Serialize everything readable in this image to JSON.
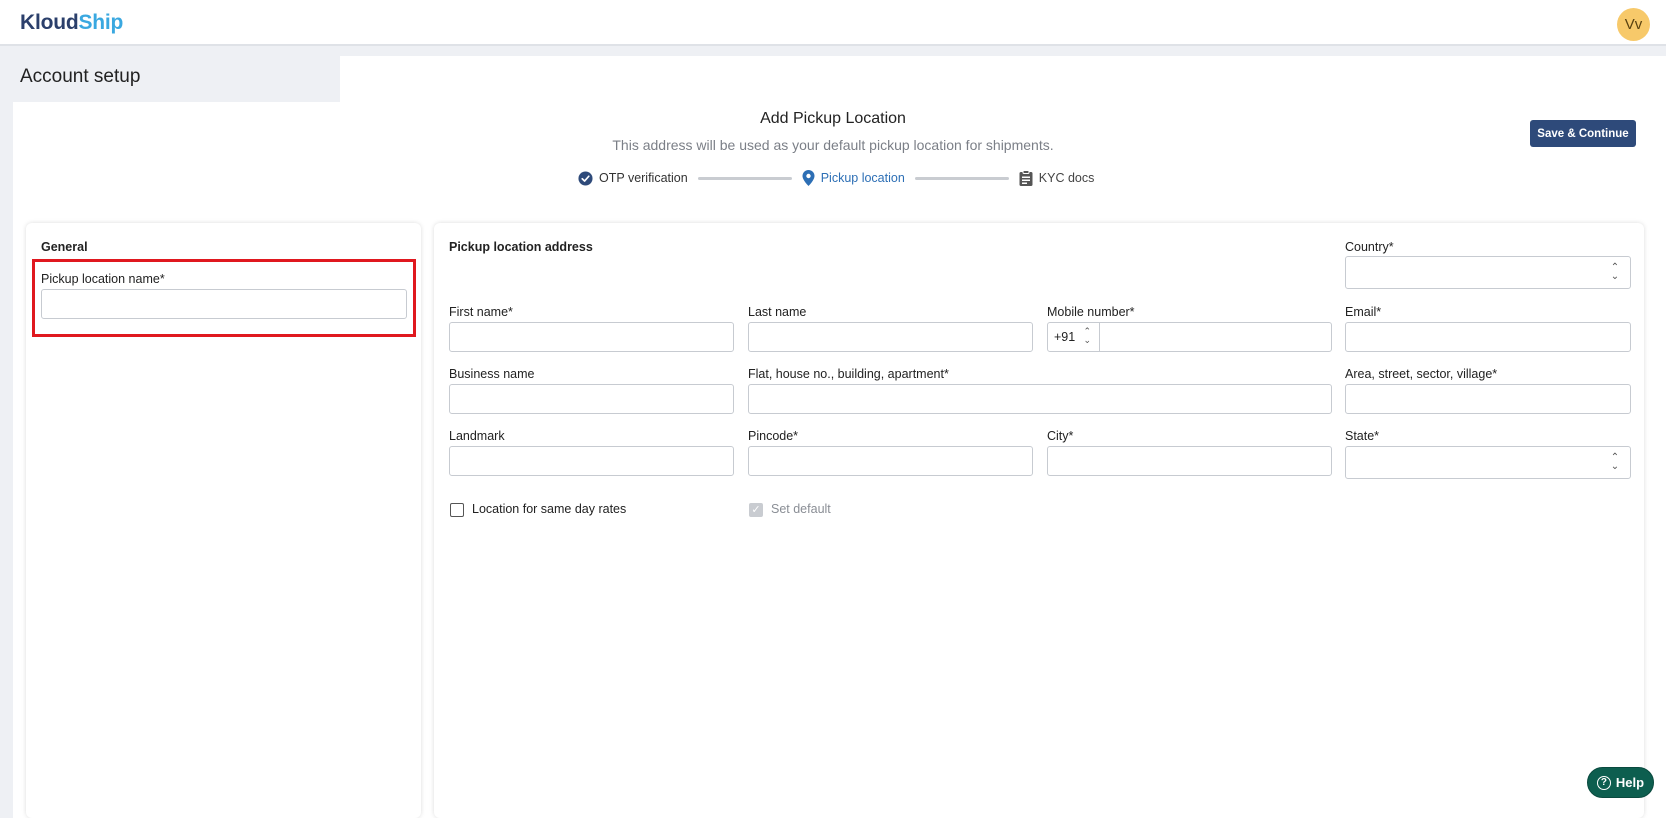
{
  "header": {
    "logo_part1": "Kloud",
    "logo_part2": "Ship",
    "avatar_initials": "Vv"
  },
  "page": {
    "title": "Account setup",
    "heading": "Add Pickup Location",
    "subheading": "This address will be used as your default pickup location for shipments.",
    "save_label": "Save & Continue"
  },
  "stepper": {
    "steps": [
      {
        "label": "OTP verification",
        "state": "completed"
      },
      {
        "label": "Pickup location",
        "state": "active"
      },
      {
        "label": "KYC docs",
        "state": "pending"
      }
    ]
  },
  "general": {
    "title": "General",
    "pickup_name_label": "Pickup location name*",
    "pickup_name_value": ""
  },
  "address": {
    "title": "Pickup location address",
    "country_label": "Country*",
    "first_name_label": "First name*",
    "last_name_label": "Last name",
    "mobile_label": "Mobile number*",
    "mobile_prefix": "+91",
    "email_label": "Email*",
    "business_label": "Business name",
    "flat_label": "Flat, house no., building, apartment*",
    "area_label": "Area, street, sector, village*",
    "landmark_label": "Landmark",
    "pincode_label": "Pincode*",
    "city_label": "City*",
    "state_label": "State*",
    "same_day_label": "Location for same day rates",
    "same_day_checked": false,
    "set_default_label": "Set default",
    "set_default_checked": true
  },
  "help": {
    "label": "Help"
  },
  "colors": {
    "brand_dark": "#2b3f6b",
    "brand_light": "#3aa8e0",
    "primary_button": "#2e4a7a",
    "active_step": "#2d6fb5",
    "help_button": "#0d5e4f",
    "highlight": "#e0181f"
  }
}
